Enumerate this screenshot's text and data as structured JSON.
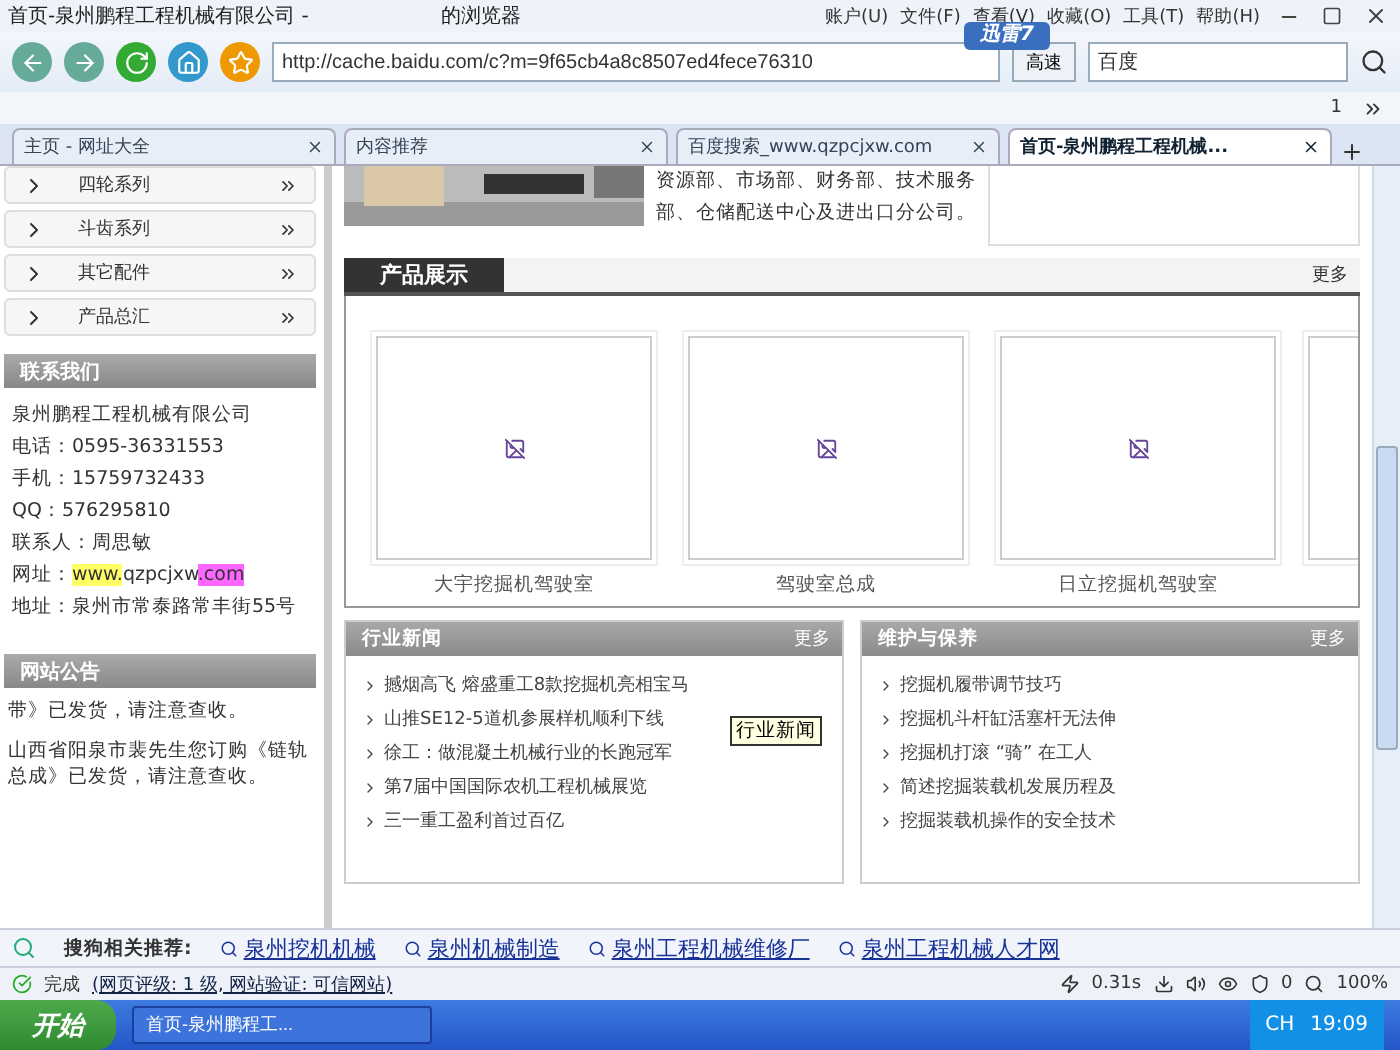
{
  "window": {
    "title": "首页-泉州鹏程工程机械有限公司 -",
    "title_suffix": "的浏览器"
  },
  "menu": [
    "账户(U)",
    "文件(F)",
    "查看(V)",
    "收藏(O)",
    "工具(T)",
    "帮助(H)"
  ],
  "toolbar": {
    "address": "http://cache.baidu.com/c?m=9f65cb4a8c8507ed4fece76310",
    "speed_button": "高速",
    "search_engine": "百度",
    "badge": "迅雷7"
  },
  "favorites_bar": {
    "count": "1"
  },
  "tabs": [
    {
      "label": "主页 - 网址大全",
      "selected": false
    },
    {
      "label": "内容推荐",
      "selected": false
    },
    {
      "label": "百度搜索_www.qzpcjxw.com",
      "selected": false
    },
    {
      "label": "首页-泉州鹏程工程机械...",
      "selected": true
    }
  ],
  "sidebar": {
    "categories": [
      "四轮系列",
      "斗齿系列",
      "其它配件",
      "产品总汇"
    ],
    "contact": {
      "title": "联系我们",
      "company": "泉州鹏程工程机械有限公司",
      "lines": [
        "电话：0595-36331553",
        "手机：15759732433",
        "QQ：576295810",
        "联系人：周思敏"
      ],
      "website": {
        "label": "网址：",
        "parts": [
          {
            "text": "www.",
            "color": "#ffff66"
          },
          {
            "text": "qzpcjxw"
          },
          {
            "text": ".com",
            "color": "#ff66ff"
          }
        ]
      },
      "address": "地址：泉州市常泰路常丰街55号"
    },
    "notice": {
      "title": "网站公告",
      "items": [
        "带》已发货，请注意查收。",
        "山西省阳泉市裴先生您订购《链轨总成》已发货，请注意查收。"
      ]
    }
  },
  "intro": {
    "text": "资源部、市场部、财务部、技术服务部、仓储配送中心及进出口分公司。"
  },
  "products": {
    "title": "产品展示",
    "more": "更多",
    "items": [
      {
        "caption": "大宇挖掘机驾驶室"
      },
      {
        "caption": "驾驶室总成"
      },
      {
        "caption": "日立挖掘机驾驶室"
      }
    ]
  },
  "panels": [
    {
      "title": "行业新闻",
      "more": "更多",
      "items": [
        "撼烟高飞 熔盛重工8款挖掘机亮相宝马",
        "山推SE12-5道机参展样机顺利下线",
        "徐工：做混凝土机械行业的长跑冠军",
        "第7届中国国际农机工程机械展览",
        "三一重工盈利首过百亿"
      ]
    },
    {
      "title": "维护与保养",
      "more": "更多",
      "items": [
        "挖掘机履带调节技巧",
        "挖掘机斗杆缸活塞杆无法伸",
        "挖掘机打滚 “骑” 在工人",
        "简述挖掘装载机发展历程及",
        "挖掘装载机操作的安全技术"
      ]
    }
  ],
  "tooltip": "行业新闻",
  "sogou": {
    "label": "搜狗相关推荐:",
    "links": [
      "泉州挖机机械",
      "泉州机械制造",
      "泉州工程机械维修厂",
      "泉州工程机械人才网"
    ]
  },
  "status": {
    "text": "完成",
    "detail": "(网页评级: 1 级, 网站验证: 可信网站)",
    "time": "0.31s",
    "count": "0",
    "zoom": "100%"
  },
  "taskbar": {
    "start": "开始",
    "task": "首页-泉州鹏程工...",
    "lang": "CH",
    "clock": "19:09"
  }
}
